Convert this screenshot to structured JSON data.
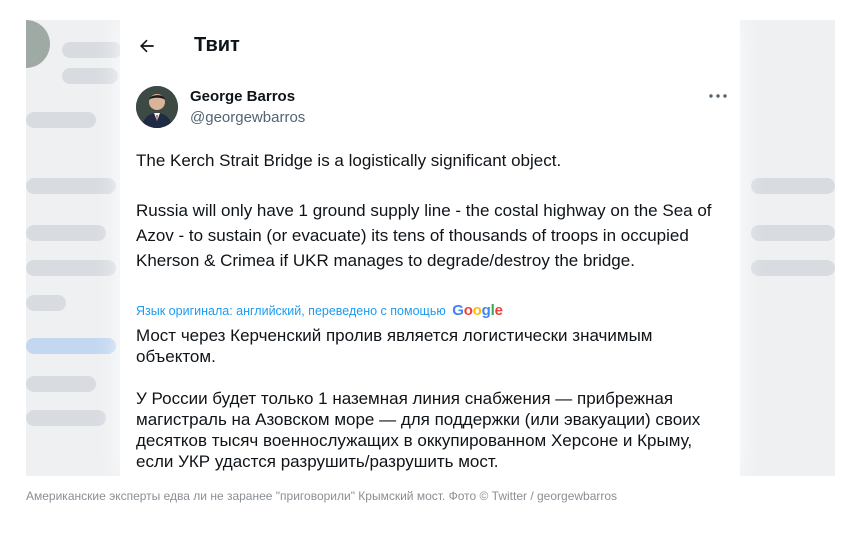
{
  "header": {
    "title": "Твит"
  },
  "tweet": {
    "author_name": "George Barros",
    "author_handle": "@georgewbarros",
    "original_paragraphs": [
      "The Kerch Strait Bridge is a logistically significant object.",
      "Russia will only have 1 ground supply line - the costal highway on the Sea of Azov - to sustain (or evacuate) its tens of thousands of troops in occupied Kherson & Crimea if UKR manages to degrade/destroy the bridge."
    ],
    "translation_note": "Язык оригинала: английский, переведено с помощью",
    "translation_provider": "Google",
    "translated_paragraphs": [
      "Мост через Керченский пролив является логистически значимым объектом.",
      "У России будет только 1 наземная линия снабжения — прибрежная магистраль на Азовском море — для поддержки (или эвакуации) своих десятков тысяч военнослужащих в оккупированном Херсоне и Крыму, если УКР удастся разрушить/разрушить мост."
    ]
  },
  "icons": {
    "back": "arrow-left-icon",
    "more": "more-horizontal-icon"
  },
  "colors": {
    "link_blue": "#1d9bf0",
    "text_primary": "#0f1419",
    "text_secondary": "#536471",
    "google_blue": "#4285F4",
    "google_red": "#EA4335",
    "google_yellow": "#FBBC05",
    "google_green": "#34A853"
  },
  "caption": "Американские эксперты едва ли не заранее \"приговорили\" Крымский мост. Фото © Twitter / georgewbarros"
}
